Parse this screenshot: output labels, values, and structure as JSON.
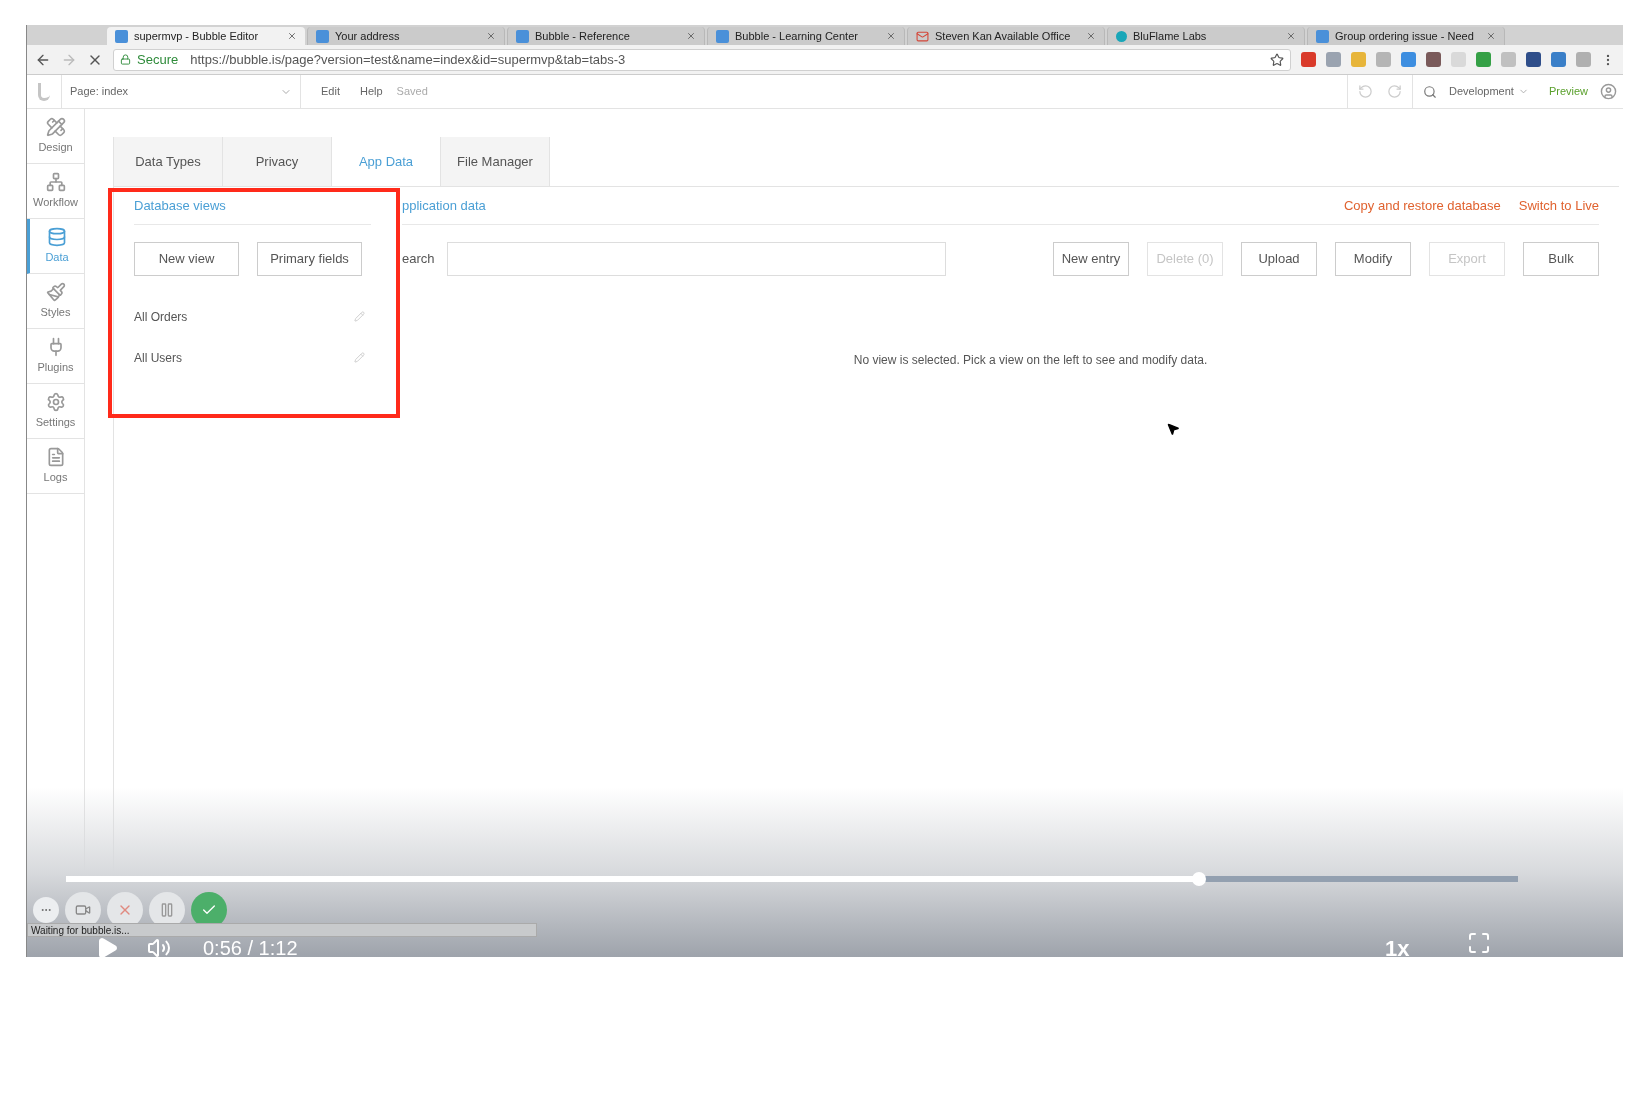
{
  "browser": {
    "tabs": [
      {
        "title": "supermvp - Bubble Editor",
        "selected": true,
        "kind": "bubble"
      },
      {
        "title": "Your address",
        "selected": false,
        "kind": "bubble"
      },
      {
        "title": "Bubble - Reference",
        "selected": false,
        "kind": "bubble"
      },
      {
        "title": "Bubble - Learning Center",
        "selected": false,
        "kind": "bubble"
      },
      {
        "title": "Steven Kan Available Office",
        "selected": false,
        "kind": "mail"
      },
      {
        "title": "BluFlame Labs",
        "selected": false,
        "kind": "dot"
      },
      {
        "title": "Group ordering issue - Need",
        "selected": false,
        "kind": "bubble"
      }
    ],
    "address": {
      "secure_label": "Secure",
      "url": "https://bubble.is/page?version=test&name=index&id=supermvp&tab=tabs-3"
    }
  },
  "editor": {
    "page_selector": "Page: index",
    "menu": [
      "Edit",
      "Help"
    ],
    "save_status": "Saved",
    "environment": "Development",
    "preview": "Preview"
  },
  "sidebar": {
    "items": [
      {
        "label": "Design",
        "kind": "design",
        "selected": false
      },
      {
        "label": "Workflow",
        "kind": "workflow",
        "selected": false
      },
      {
        "label": "Data",
        "kind": "data",
        "selected": true
      },
      {
        "label": "Styles",
        "kind": "styles",
        "selected": false
      },
      {
        "label": "Plugins",
        "kind": "plugins",
        "selected": false
      },
      {
        "label": "Settings",
        "kind": "settings",
        "selected": false
      },
      {
        "label": "Logs",
        "kind": "logs",
        "selected": false
      }
    ]
  },
  "tabs": [
    {
      "label": "Data Types",
      "selected": false
    },
    {
      "label": "Privacy",
      "selected": false
    },
    {
      "label": "App Data",
      "selected": true
    },
    {
      "label": "File Manager",
      "selected": false
    }
  ],
  "database_views": {
    "title": "Database views",
    "buttons": [
      "New view",
      "Primary fields"
    ],
    "views": [
      {
        "name": "All Orders"
      },
      {
        "name": "All Users"
      }
    ]
  },
  "application_data": {
    "title": "pplication data",
    "links": [
      "Copy and restore database",
      "Switch to Live"
    ],
    "search_label": "earch",
    "actions": [
      {
        "label": "New entry",
        "disabled": false
      },
      {
        "label": "Delete (0)",
        "disabled": true
      },
      {
        "label": "Upload",
        "disabled": false
      },
      {
        "label": "Modify",
        "disabled": false
      },
      {
        "label": "Export",
        "disabled": true
      },
      {
        "label": "Bulk",
        "disabled": false
      }
    ],
    "empty_message": "No view is selected. Pick a view on the left to see and modify data."
  },
  "recorder": {
    "status": "Waiting for bubble.is..."
  },
  "video": {
    "level": 0.78,
    "time": "0:56 / 1:12",
    "speed": "1x"
  }
}
